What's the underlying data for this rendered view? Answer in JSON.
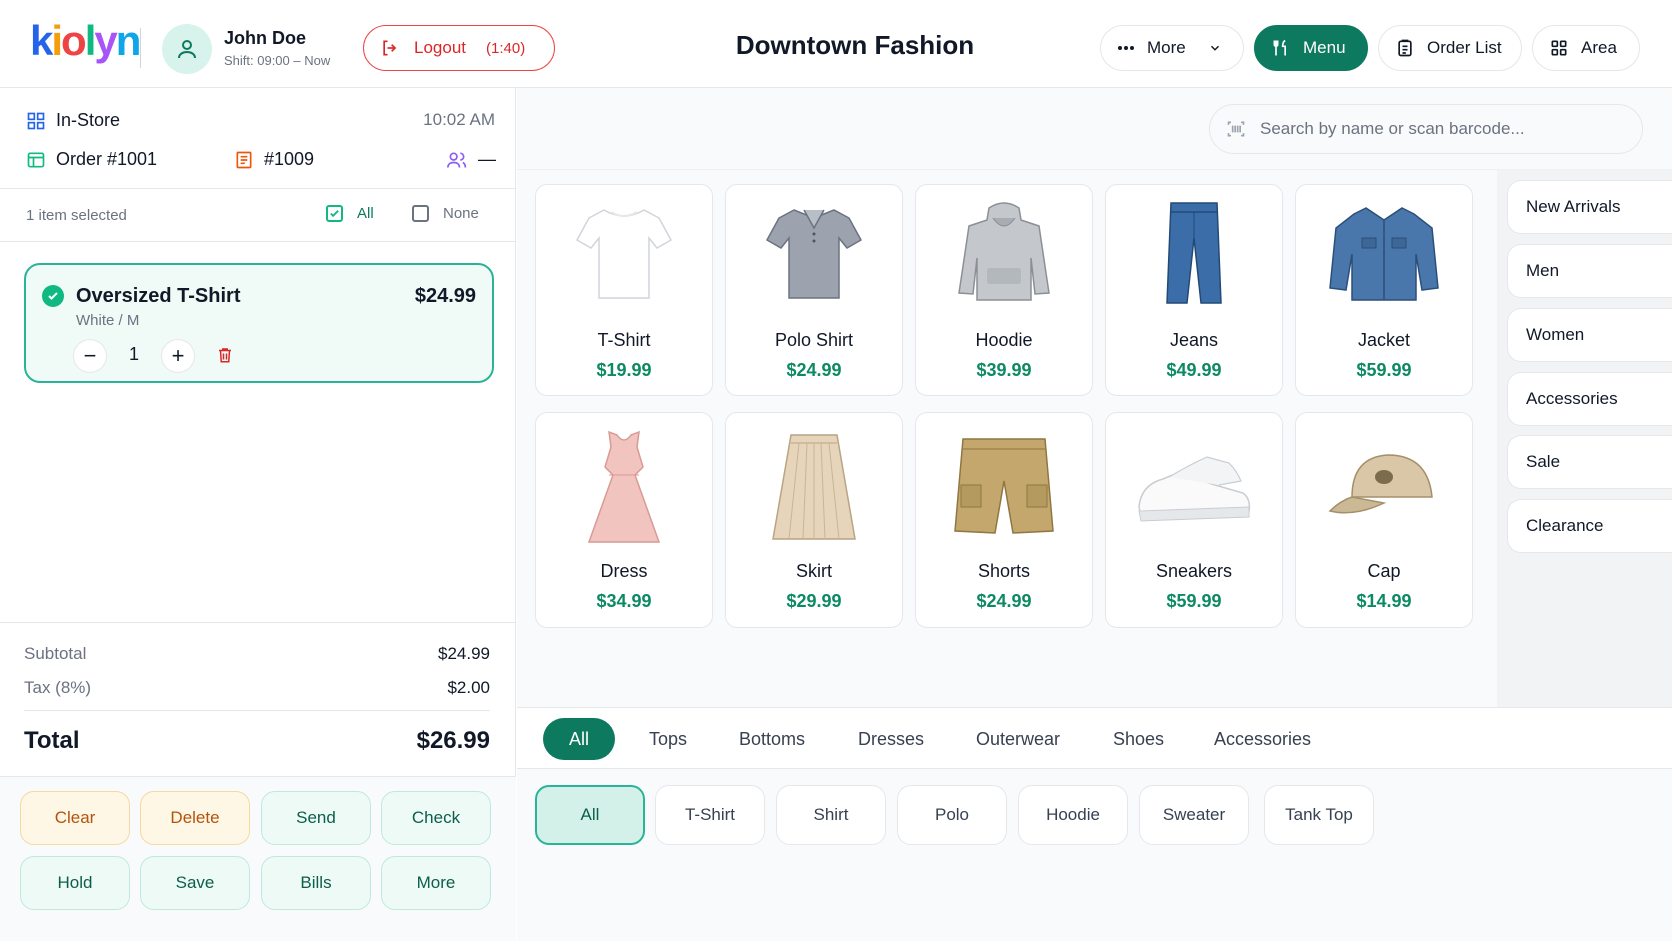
{
  "header": {
    "logo_letters": [
      "k",
      "i",
      "o",
      "l",
      "y",
      "n"
    ],
    "logo_colors": [
      "#2563eb",
      "#f59e0b",
      "#ef4444",
      "#10b981",
      "#a855f7",
      "#0ea5e9"
    ],
    "user_name": "John Doe",
    "shift": "Shift: 09:00 – Now",
    "logout_label": "Logout",
    "logout_timer": "(1:40)",
    "shop_title": "Downtown Fashion",
    "more_label": "More",
    "menu_label": "Menu",
    "orders_label": "Order List",
    "area_label": "Area"
  },
  "order": {
    "mode": "In-Store",
    "time": "10:02 AM",
    "order_no": "Order #1001",
    "ticket_no": "#1009",
    "guests": "—"
  },
  "selection": {
    "count_text": "1 item selected",
    "all_label": "All",
    "none_label": "None"
  },
  "cart_item": {
    "name": "Oversized T-Shirt",
    "price": "$24.99",
    "variant": "White / M",
    "qty": "1",
    "minus": "−",
    "plus": "+"
  },
  "totals": {
    "subtotal_label": "Subtotal",
    "subtotal": "$24.99",
    "tax_label": "Tax (8%)",
    "tax": "$2.00",
    "total_label": "Total",
    "total": "$26.99"
  },
  "actions": [
    "Clear",
    "Delete",
    "Send",
    "Check",
    "Hold",
    "Save",
    "Bills",
    "More"
  ],
  "search": {
    "placeholder": "Search by name or scan barcode..."
  },
  "products": [
    {
      "name": "T-Shirt",
      "price": "$19.99",
      "icon": "tshirt-image"
    },
    {
      "name": "Polo Shirt",
      "price": "$24.99",
      "icon": "polo-image"
    },
    {
      "name": "Hoodie",
      "price": "$39.99",
      "icon": "hoodie-image"
    },
    {
      "name": "Jeans",
      "price": "$49.99",
      "icon": "jeans-image"
    },
    {
      "name": "Jacket",
      "price": "$59.99",
      "icon": "jacket-image"
    },
    {
      "name": "Dress",
      "price": "$34.99",
      "icon": "dress-image"
    },
    {
      "name": "Skirt",
      "price": "$29.99",
      "icon": "skirt-image"
    },
    {
      "name": "Shorts",
      "price": "$24.99",
      "icon": "shorts-image"
    },
    {
      "name": "Sneakers",
      "price": "$59.99",
      "icon": "sneakers-image"
    },
    {
      "name": "Cap",
      "price": "$14.99",
      "icon": "cap-image"
    }
  ],
  "side_categories": [
    "New Arrivals",
    "Men",
    "Women",
    "Accessories",
    "Sale",
    "Clearance"
  ],
  "tabs": [
    "All",
    "Tops",
    "Bottoms",
    "Dresses",
    "Outerwear",
    "Shoes",
    "Accessories"
  ],
  "subcategories": [
    "All",
    "T-Shirt",
    "Shirt",
    "Polo",
    "Hoodie",
    "Sweater",
    "Tank Top"
  ],
  "colors": {
    "accent": "#0d7a5f",
    "price": "#0d8a63",
    "danger": "#dc2626"
  }
}
